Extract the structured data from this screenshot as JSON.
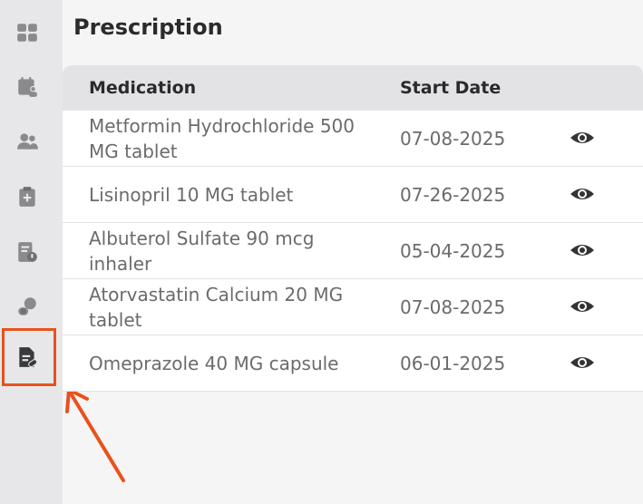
{
  "page": {
    "title": "Prescription"
  },
  "sidebar": {
    "items": [
      {
        "icon": "dashboard-icon"
      },
      {
        "icon": "calendar-user-icon"
      },
      {
        "icon": "users-icon"
      },
      {
        "icon": "clipboard-plus-icon"
      },
      {
        "icon": "lab-report-icon"
      },
      {
        "icon": "pills-icon"
      },
      {
        "icon": "prescription-icon",
        "active": true
      }
    ]
  },
  "table": {
    "headers": {
      "medication": "Medication",
      "start_date": "Start Date"
    },
    "rows": [
      {
        "medication": "Metformin Hydrochloride 500 MG tablet",
        "start_date": "07-08-2025"
      },
      {
        "medication": "Lisinopril 10 MG tablet",
        "start_date": "07-26-2025"
      },
      {
        "medication": "Albuterol Sulfate 90 mcg inhaler",
        "start_date": "05-04-2025"
      },
      {
        "medication": "Atorvastatin Calcium 20 MG tablet",
        "start_date": "07-08-2025"
      },
      {
        "medication": "Omeprazole 40 MG capsule",
        "start_date": "06-01-2025"
      }
    ]
  },
  "colors": {
    "highlight": "#e8521c",
    "icon": "#7b7b7e",
    "active_icon": "#3a3a3d"
  }
}
